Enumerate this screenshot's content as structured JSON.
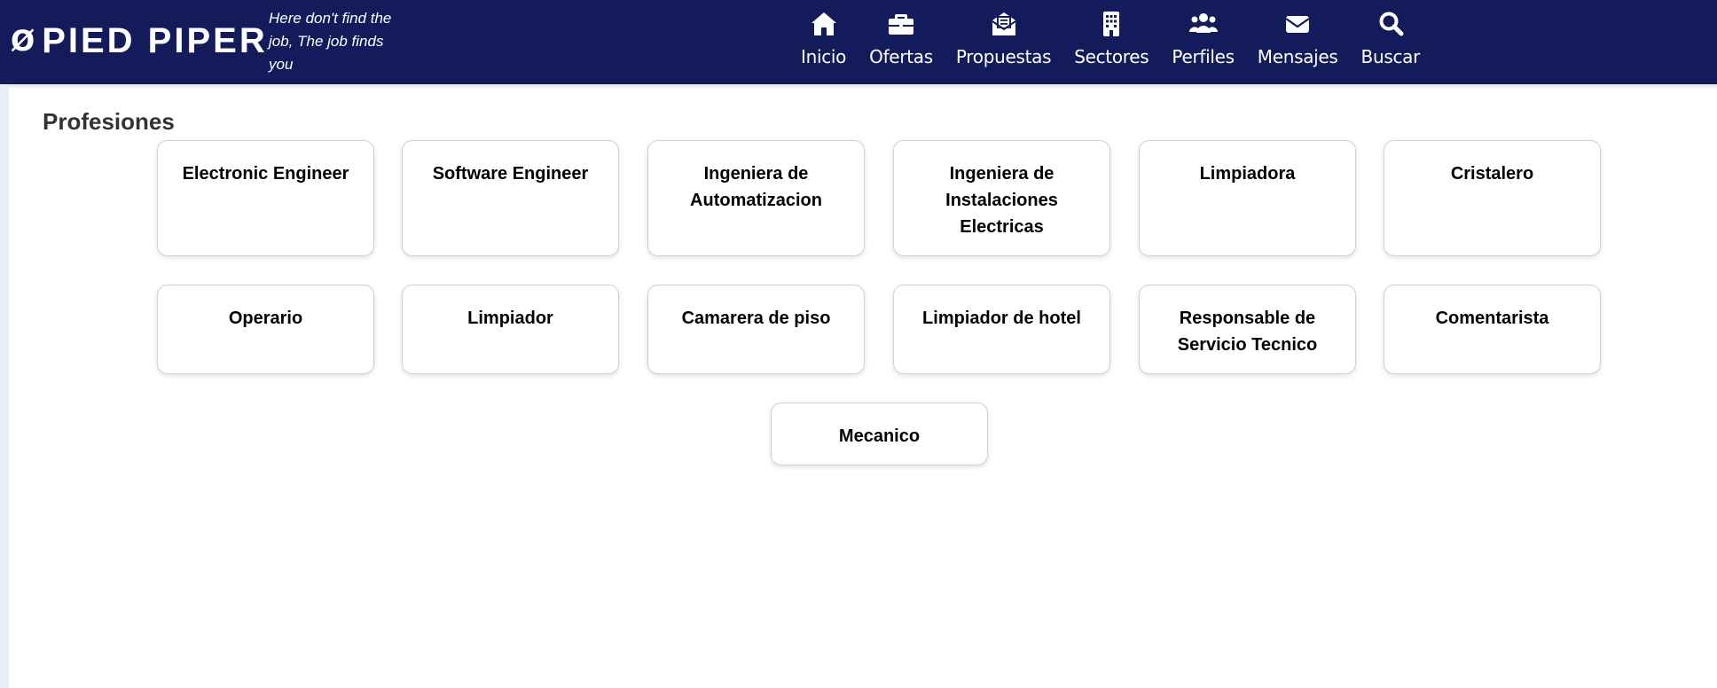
{
  "header": {
    "brand_logo": "Ø",
    "brand_name": "PIED PIPER",
    "tagline": "Here don't find the job, The job finds you",
    "nav": [
      {
        "label": "Inicio",
        "icon": "home-icon"
      },
      {
        "label": "Ofertas",
        "icon": "briefcase-icon"
      },
      {
        "label": "Propuestas",
        "icon": "envelope-open-icon"
      },
      {
        "label": "Sectores",
        "icon": "building-icon"
      },
      {
        "label": "Perfiles",
        "icon": "users-icon"
      },
      {
        "label": "Mensajes",
        "icon": "envelope-icon"
      },
      {
        "label": "Buscar",
        "icon": "search-icon"
      }
    ]
  },
  "main": {
    "title": "Profesiones",
    "professions": [
      "Electronic Engineer",
      "Software Engineer",
      "Ingeniera de Automatizacion",
      "Ingeniera de Instalaciones Electricas",
      "Limpiadora",
      "Cristalero",
      "Operario",
      "Limpiador",
      "Camarera de piso",
      "Limpiador de hotel",
      "Responsable de Servicio Tecnico",
      "Comentarista",
      "Mecanico"
    ]
  },
  "colors": {
    "header_bg": "#131b5a",
    "header_text": "#ffffff",
    "card_border": "#d2d2d2",
    "title_text": "#333333"
  }
}
